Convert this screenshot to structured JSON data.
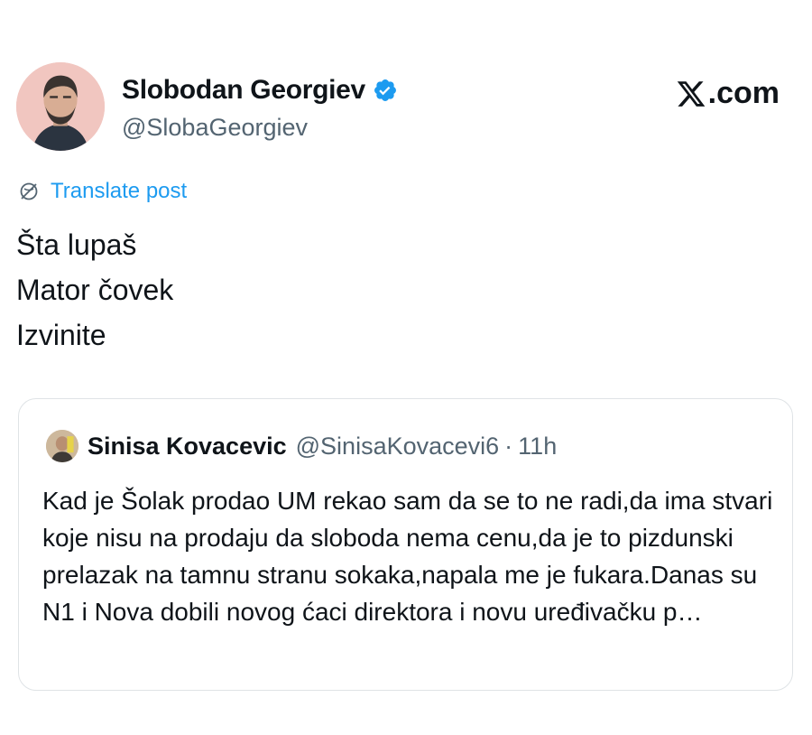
{
  "author": {
    "display_name": "Slobodan Georgiev",
    "handle": "@SlobaGeorgiev",
    "avatar_icon": "avatar-man-bald-beard",
    "verified_icon": "verified-badge-icon",
    "verified_color": "#1d9bf0"
  },
  "brand": {
    "label": ".com",
    "icon": "x-logo-icon"
  },
  "translate": {
    "label": "Translate post",
    "icon": "globe-icon",
    "color": "#1d9bf0"
  },
  "post": {
    "lines": [
      "Šta lupaš",
      "Mator čovek",
      "Izvinite"
    ]
  },
  "quoted_post": {
    "display_name": "Sinisa Kovacevic",
    "handle": "@SinisaKovacevi6",
    "separator": "·",
    "time": "11h",
    "text": "Kad je Šolak prodao UM rekao sam da se to ne radi,da ima stvari koje nisu na prodaju da sloboda nema cenu,da je to pizdunski prelazak na tamnu stranu sokaka,napala me je fukara.Danas su N1 i Nova dobili novog ćaci direktora i novu uređivačku p…"
  }
}
